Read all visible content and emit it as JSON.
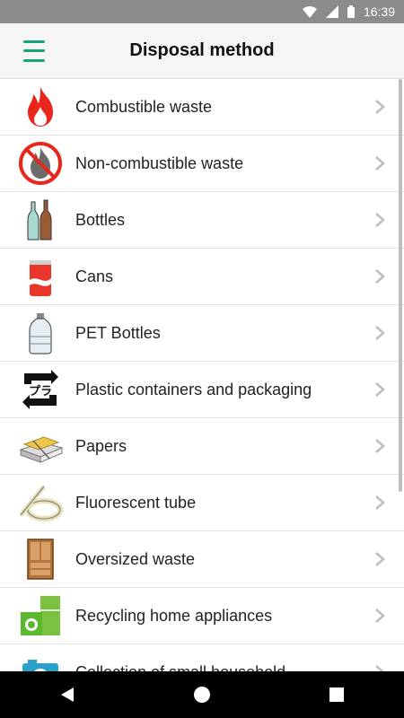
{
  "status_bar": {
    "time": "16:39",
    "icons": [
      "wifi-icon",
      "signal-icon",
      "battery-icon"
    ]
  },
  "app_bar": {
    "title": "Disposal method",
    "menu_icon": "hamburger-menu-icon"
  },
  "colors": {
    "accent": "#17a47a",
    "status_bar": "#8c8c8c",
    "divider": "#e0e0e0"
  },
  "items": [
    {
      "label": "Combustible waste",
      "icon": "fire-icon"
    },
    {
      "label": "Non-combustible waste",
      "icon": "no-fire-icon"
    },
    {
      "label": "Bottles",
      "icon": "bottles-icon"
    },
    {
      "label": "Cans",
      "icon": "can-icon"
    },
    {
      "label": "PET Bottles",
      "icon": "pet-bottle-icon"
    },
    {
      "label": "Plastic containers and packaging",
      "icon": "plastic-recycle-icon"
    },
    {
      "label": "Papers",
      "icon": "papers-icon"
    },
    {
      "label": "Fluorescent tube",
      "icon": "fluorescent-tube-icon"
    },
    {
      "label": "Oversized waste",
      "icon": "cabinet-icon"
    },
    {
      "label": "Recycling home appliances",
      "icon": "appliances-icon"
    },
    {
      "label": "Collection of small household",
      "icon": "camera-icon"
    }
  ],
  "nav_bar": {
    "buttons": [
      "back-icon",
      "home-icon",
      "recents-icon"
    ]
  }
}
